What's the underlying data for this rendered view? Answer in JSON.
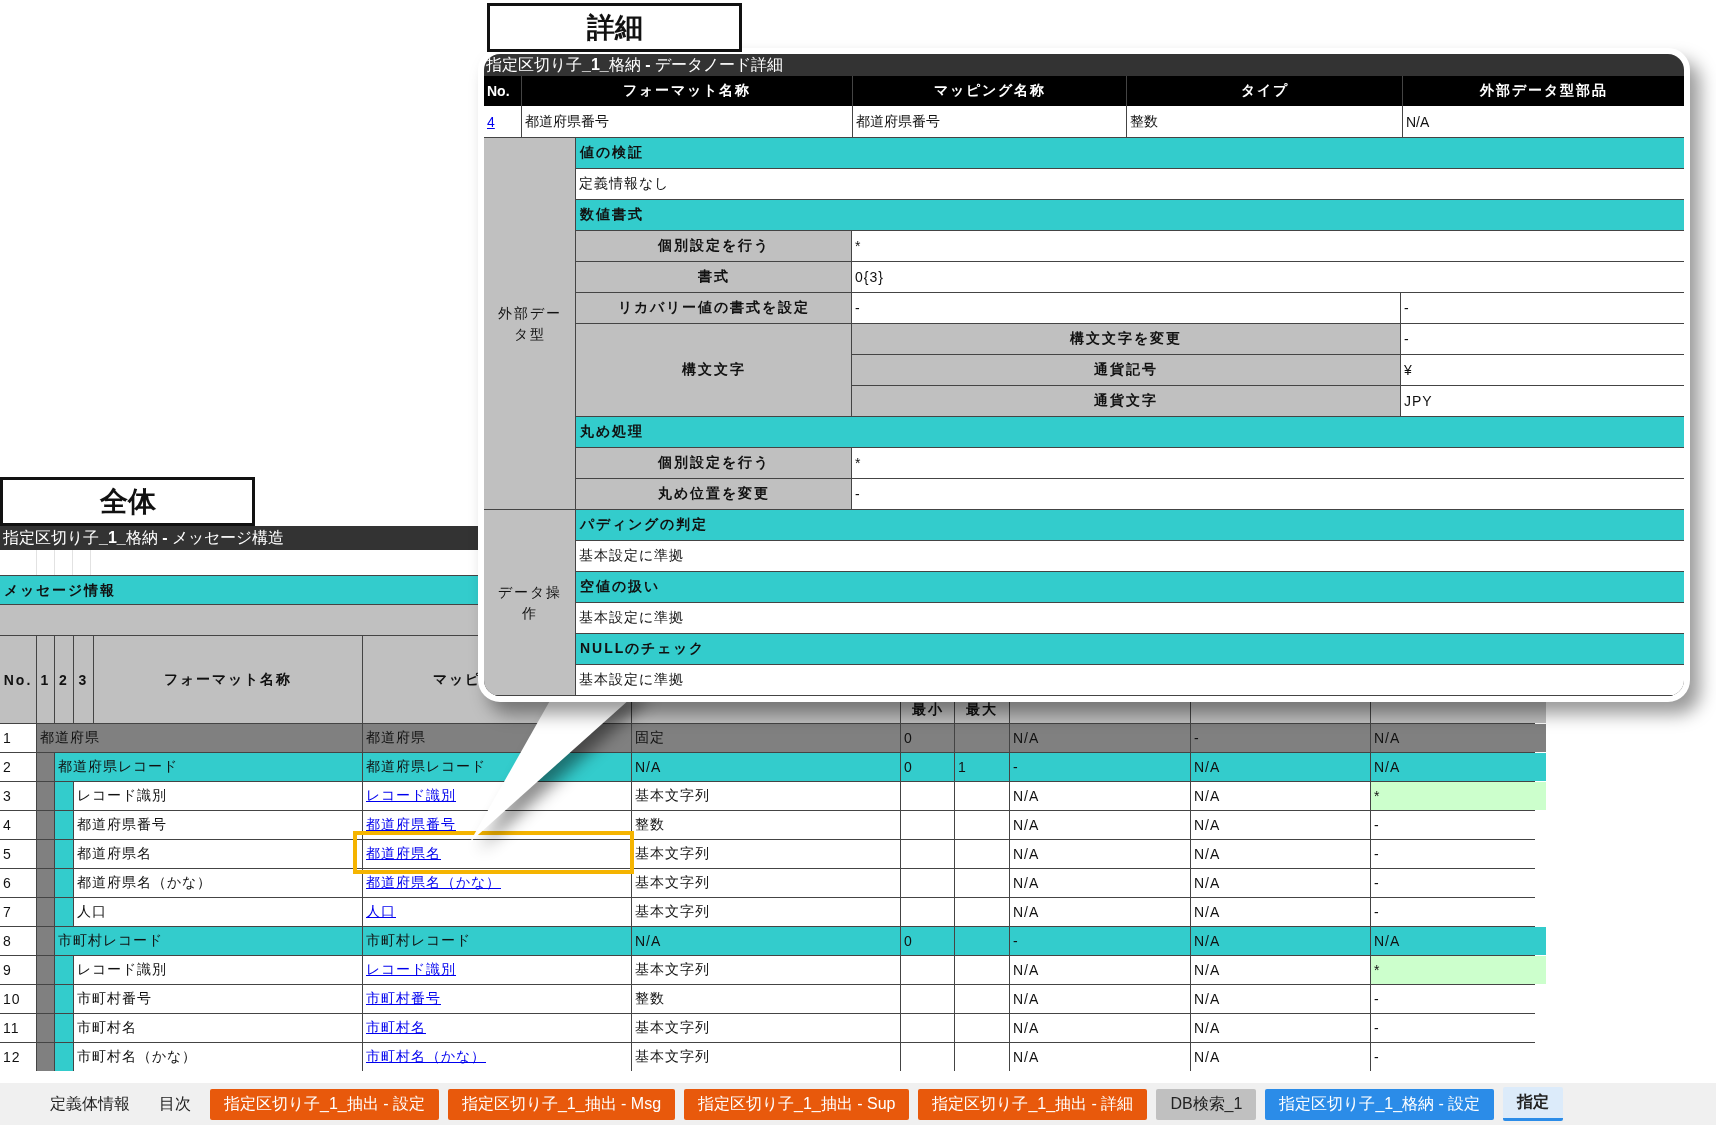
{
  "overview": {
    "label": "全体",
    "title": "指定区切り子**_1_**格納 **-** メッセージ構造",
    "section": "メッセージ情報",
    "header": {
      "no": "No.",
      "levels": [
        "1",
        "2",
        "3"
      ],
      "name": "フォーマット名称",
      "mapping": "マッピ",
      "min": "最小",
      "max": "最大"
    },
    "rows": [
      {
        "no": "1",
        "kind": "group",
        "name": "都道府県",
        "mapping": "都道府県",
        "type": "固定",
        "min": "0",
        "c1": "N/A",
        "c2": "-",
        "c3": "N/A",
        "highlighted": false,
        "callout": false,
        "children": [
          {
            "no": "2",
            "kind": "record",
            "name": "都道府県レコード",
            "mapping": "都道府県レコード",
            "type": "N/A",
            "min": "0",
            "max": "1",
            "c1": "-",
            "c2": "N/A",
            "c3": "N/A",
            "highlighted": false,
            "callout": false,
            "children": [
              {
                "no": "3",
                "kind": "field",
                "name": "レコード識別",
                "mapping": "レコード識別",
                "type": "基本文字列",
                "c1": "N/A",
                "c2": "N/A",
                "c3": "*",
                "highlighted": true,
                "callout": false
              },
              {
                "no": "4",
                "kind": "field",
                "name": "都道府県番号",
                "mapping": "都道府県番号",
                "type": "整数",
                "c1": "N/A",
                "c2": "N/A",
                "c3": "-",
                "highlighted": false,
                "callout": false
              },
              {
                "no": "5",
                "kind": "field",
                "name": "都道府県名",
                "mapping": "都道府県名",
                "type": "基本文字列",
                "c1": "N/A",
                "c2": "N/A",
                "c3": "-",
                "highlighted": false,
                "callout": true
              },
              {
                "no": "6",
                "kind": "field",
                "name": "都道府県名（かな）",
                "mapping": "都道府県名（かな）",
                "type": "基本文字列",
                "c1": "N/A",
                "c2": "N/A",
                "c3": "-",
                "highlighted": false,
                "callout": false
              },
              {
                "no": "7",
                "kind": "field",
                "name": "人口",
                "mapping": "人口",
                "type": "基本文字列",
                "c1": "N/A",
                "c2": "N/A",
                "c3": "-",
                "highlighted": false,
                "callout": false
              }
            ]
          },
          {
            "no": "8",
            "kind": "record",
            "name": "市町村レコード",
            "mapping": "市町村レコード",
            "type": "N/A",
            "min": "0",
            "c1": "-",
            "c2": "N/A",
            "c3": "N/A",
            "highlighted": false,
            "callout": false,
            "children": [
              {
                "no": "9",
                "kind": "field",
                "name": "レコード識別",
                "mapping": "レコード識別",
                "type": "基本文字列",
                "c1": "N/A",
                "c2": "N/A",
                "c3": "*",
                "highlighted": true,
                "callout": false
              },
              {
                "no": "10",
                "kind": "field",
                "name": "市町村番号",
                "mapping": "市町村番号",
                "type": "整数",
                "c1": "N/A",
                "c2": "N/A",
                "c3": "-",
                "highlighted": false,
                "callout": false
              },
              {
                "no": "11",
                "kind": "field",
                "name": "市町村名",
                "mapping": "市町村名",
                "type": "基本文字列",
                "c1": "N/A",
                "c2": "N/A",
                "c3": "-",
                "highlighted": false,
                "callout": false
              },
              {
                "no": "12",
                "kind": "field",
                "name": "市町村名（かな）",
                "mapping": "市町村名（かな）",
                "type": "基本文字列",
                "c1": "N/A",
                "c2": "N/A",
                "c3": "-",
                "highlighted": false,
                "callout": false
              }
            ]
          }
        ]
      }
    ]
  },
  "detail": {
    "label": "詳細",
    "title": "指定区切り子**_1_**格納 **-** データノード詳細",
    "columns": [
      "No.",
      "フォーマット名称",
      "マッピング名称",
      "タイプ",
      "外部データ型部品"
    ],
    "row": [
      "4",
      "都道府県番号",
      "都道府県番号",
      "整数",
      "N/A"
    ],
    "groups": [
      {
        "label": "外部データ型",
        "rows": [
          {
            "kind": "heading",
            "text": "値の検証"
          },
          {
            "kind": "text",
            "text": "定義情報なし"
          },
          {
            "kind": "heading",
            "text": "数値書式"
          },
          {
            "kind": "pair",
            "label": "個別設定を行う",
            "value": "*"
          },
          {
            "kind": "pair",
            "label": "書式",
            "value": "0{3}"
          },
          {
            "kind": "split",
            "label": "リカバリー値の書式を設定",
            "value": "-",
            "value_2": "-"
          },
          {
            "kind": "nested",
            "label": "構文文字",
            "items": [
              {
                "label": "構文文字を変更",
                "value": "-"
              },
              {
                "label": "通貨記号",
                "value": "¥"
              },
              {
                "label": "通貨文字",
                "value": "JPY"
              }
            ]
          },
          {
            "kind": "heading",
            "text": "丸め処理"
          },
          {
            "kind": "pair",
            "label": "個別設定を行う",
            "value": "*"
          },
          {
            "kind": "pair",
            "label": "丸め位置を変更",
            "value": "-"
          }
        ]
      },
      {
        "label": "データ操作",
        "rows": [
          {
            "kind": "heading",
            "text": "パディングの判定"
          },
          {
            "kind": "text",
            "text": "基本設定に準拠"
          },
          {
            "kind": "heading",
            "text": "空値の扱い"
          },
          {
            "kind": "text",
            "text": "基本設定に準拠"
          },
          {
            "kind": "heading",
            "text": "NULLのチェック"
          },
          {
            "kind": "text",
            "text": "基本設定に準拠"
          }
        ]
      }
    ]
  },
  "sheet_tabs": [
    {
      "label": "定義体情報",
      "selected": false
    },
    {
      "label": "目次",
      "selected": false
    },
    {
      "label": "指定区切り子_1_抽出 - 設定",
      "color": "#e8590c",
      "selected": false
    },
    {
      "label": "指定区切り子_1_抽出 - Msg",
      "color": "#e8590c",
      "selected": false
    },
    {
      "label": "指定区切り子_1_抽出 - Sup",
      "color": "#e8590c",
      "selected": false
    },
    {
      "label": "指定区切り子_1_抽出 - 詳細",
      "color": "#e8590c",
      "selected": false
    },
    {
      "label": "DB検索_1",
      "color": "#c0c0c0",
      "selected": false
    },
    {
      "label": "指定区切り子_1_格納 - 設定",
      "color": "#2b8ce8",
      "selected": false
    },
    {
      "label": "指定",
      "color": "#dcebfa",
      "selected": true
    }
  ]
}
